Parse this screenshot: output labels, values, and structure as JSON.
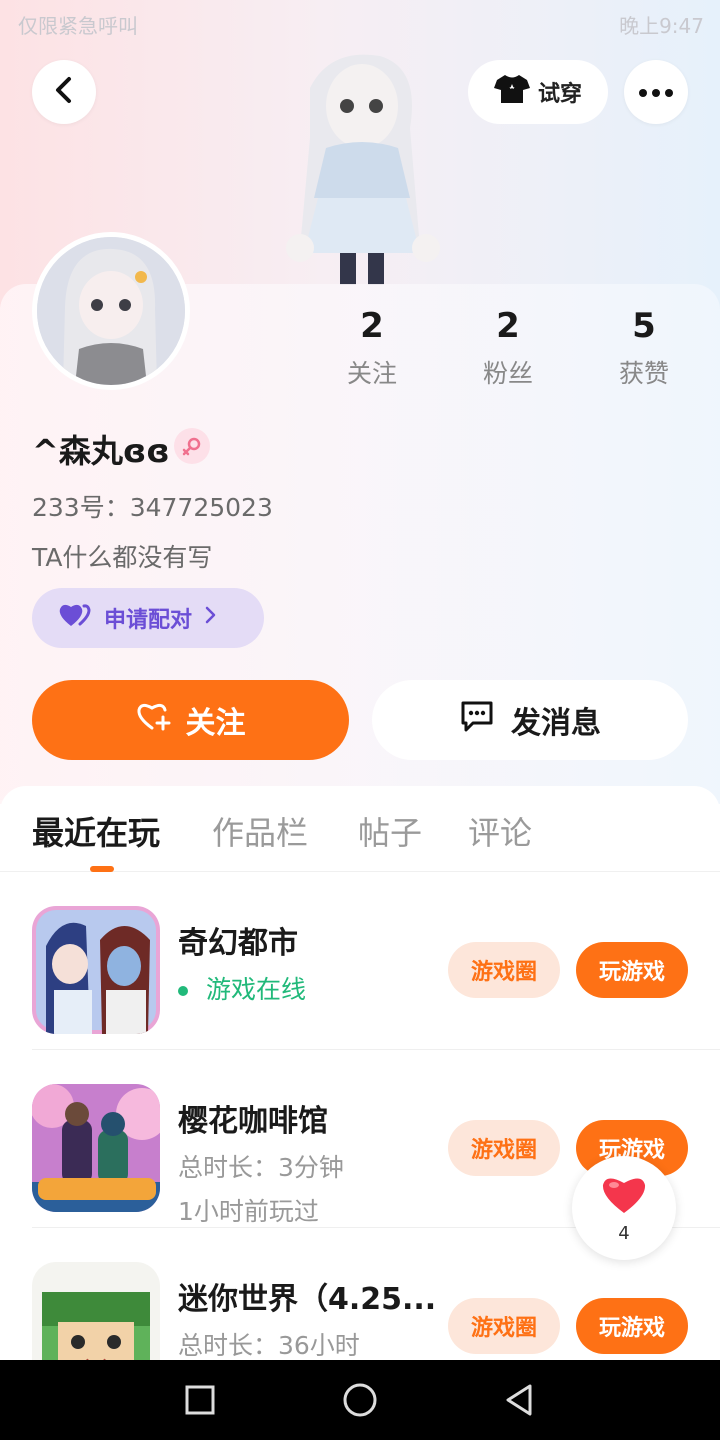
{
  "status_bar": {
    "left": "仅限紧急呼叫",
    "right": "晚上9:47"
  },
  "header": {
    "try_on_label": "试穿"
  },
  "profile": {
    "name": "^森丸ɞɞ",
    "uid": "233号：347725023",
    "bio": "TA什么都没有写",
    "pair_label": "申请配对",
    "stats": [
      {
        "value": "2",
        "label": "关注"
      },
      {
        "value": "2",
        "label": "粉丝"
      },
      {
        "value": "5",
        "label": "获赞"
      }
    ]
  },
  "actions": {
    "follow_label": "关注",
    "message_label": "发消息"
  },
  "tabs": [
    {
      "label": "最近在玩",
      "active": true
    },
    {
      "label": "作品栏",
      "active": false
    },
    {
      "label": "帖子",
      "active": false
    },
    {
      "label": "评论",
      "active": false
    }
  ],
  "games": [
    {
      "name": "奇幻都市",
      "line1": "游戏在线",
      "line2": "",
      "online": true,
      "circle_label": "游戏圈",
      "play_label": "玩游戏"
    },
    {
      "name": "樱花咖啡馆",
      "line1": "总时长：3分钟",
      "line2": "1小时前玩过",
      "online": false,
      "circle_label": "游戏圈",
      "play_label": "玩游戏"
    },
    {
      "name": "迷你世界（4.25...",
      "line1": "总时长：36小时",
      "line2": "",
      "online": false,
      "circle_label": "游戏圈",
      "play_label": "玩游戏"
    }
  ],
  "like_fab": {
    "count": "4"
  },
  "colors": {
    "accent": "#fe7115",
    "pair": "#6b4ed6",
    "online": "#21b97a"
  },
  "icons": [
    "back-arrow-icon",
    "shirt-icon",
    "more-icon",
    "female-icon",
    "heart-pair-icon",
    "chevron-right-icon",
    "heart-plus-icon",
    "chat-bubble-icon",
    "heart-icon",
    "square-nav-icon",
    "circle-nav-icon",
    "triangle-back-nav-icon"
  ]
}
